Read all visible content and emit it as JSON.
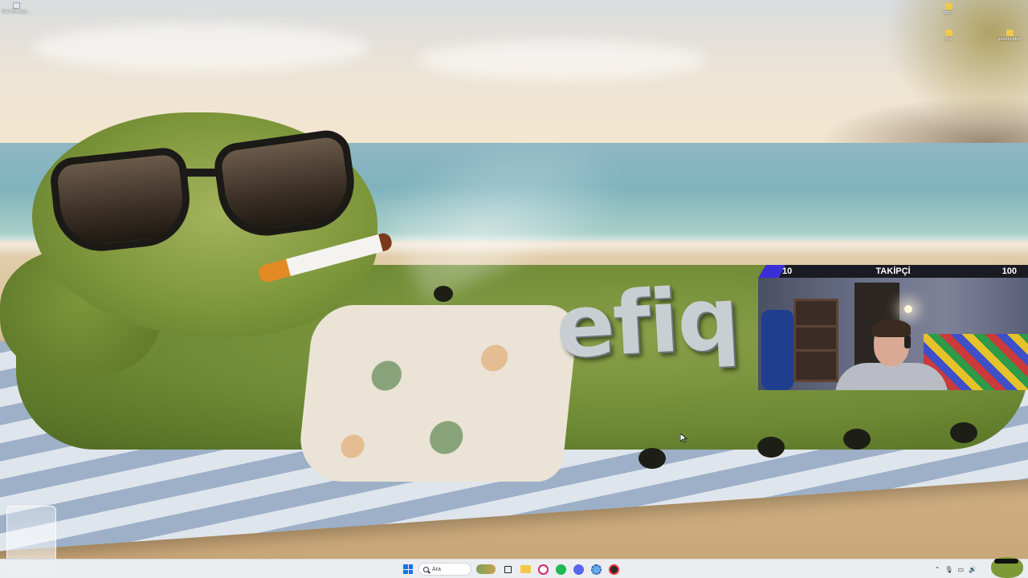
{
  "desktop": {
    "icons": [
      {
        "name": "recycle-bin",
        "label": "Geri Dönüşü..."
      },
      {
        "name": "folder-1",
        "label": "gzcf"
      },
      {
        "name": "folder-2",
        "label": "gfx"
      },
      {
        "name": "folder-3",
        "label": "goodbyebyt"
      }
    ],
    "wallpaper_text": "efiq"
  },
  "stream_overlay": {
    "follower_goal": {
      "current": "10",
      "label": "TAKİPÇİ",
      "target": "100",
      "progress_fraction": 0.1
    },
    "colors": {
      "bar_fill": "#3a2fd6",
      "bar_bg": "#1a1a22"
    }
  },
  "taskbar": {
    "search_placeholder": "Ara",
    "apps": [
      "start-icon",
      "search-box",
      "widgets-icon",
      "task-view-icon",
      "file-explorer-icon",
      "opera-icon",
      "spotify-icon",
      "discord-icon",
      "settings-icon",
      "obs-icon"
    ],
    "tray": [
      "chevron-up-icon",
      "microphone-icon",
      "display-icon",
      "volume-icon"
    ]
  }
}
